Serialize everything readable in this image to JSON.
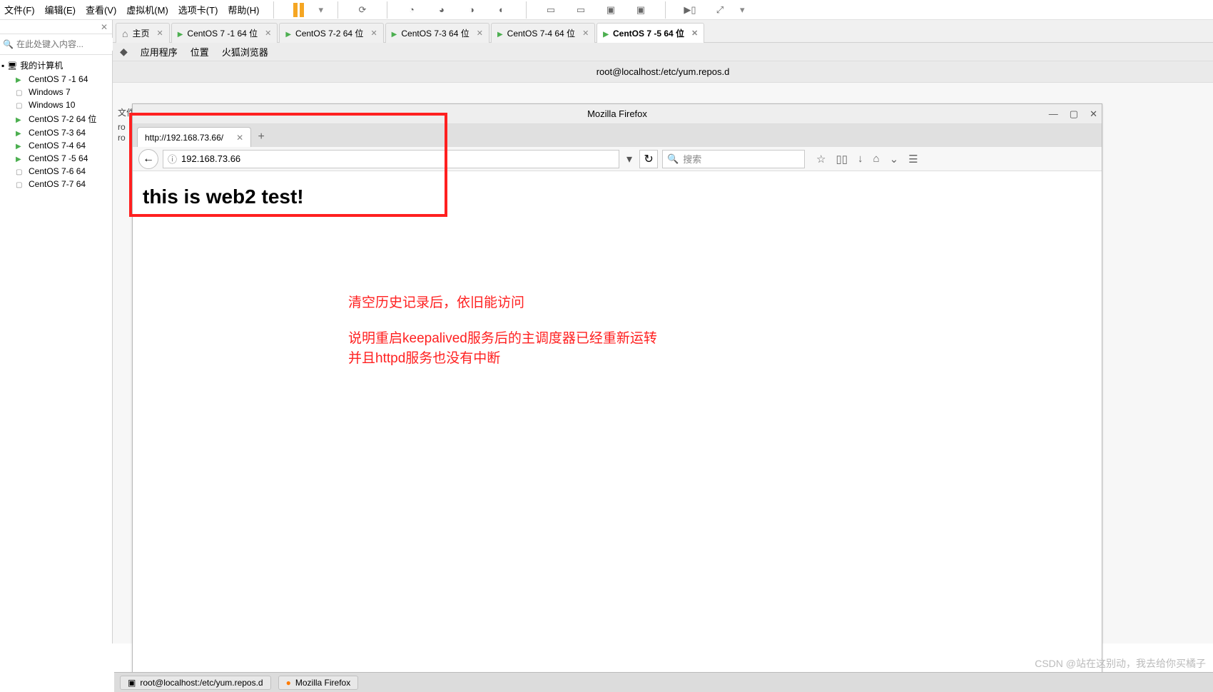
{
  "menubar": {
    "file": "文件(F)",
    "edit": "编辑(E)",
    "view": "查看(V)",
    "vm": "虚拟机(M)",
    "tabs": "选项卡(T)",
    "help": "帮助(H)"
  },
  "sidebar": {
    "search_placeholder": "在此处键入内容...",
    "root": "我的计算机",
    "items": [
      {
        "label": "CentOS 7 -1 64",
        "on": true
      },
      {
        "label": "Windows 7",
        "on": false
      },
      {
        "label": "Windows 10",
        "on": false
      },
      {
        "label": "CentOS 7-2 64 位",
        "on": true
      },
      {
        "label": "CentOS 7-3  64",
        "on": true
      },
      {
        "label": "CentOS 7-4  64",
        "on": true
      },
      {
        "label": "CentOS 7 -5 64",
        "on": true
      },
      {
        "label": "CentOS 7-6   64",
        "on": false
      },
      {
        "label": "CentOS 7-7  64",
        "on": false
      }
    ]
  },
  "tabs": [
    {
      "label": "主页",
      "type": "home",
      "active": false
    },
    {
      "label": "CentOS 7 -1 64 位",
      "type": "vm",
      "active": false
    },
    {
      "label": "CentOS 7-2 64 位",
      "type": "vm",
      "active": false
    },
    {
      "label": "CentOS 7-3  64 位",
      "type": "vm",
      "active": false
    },
    {
      "label": "CentOS 7-4  64 位",
      "type": "vm",
      "active": false
    },
    {
      "label": "CentOS 7 -5 64 位",
      "type": "vm",
      "active": true
    }
  ],
  "gnome": {
    "apps": "应用程序",
    "places": "位置",
    "firefox": "火狐浏览器"
  },
  "term_title": "root@localhost:/etc/yum.repos.d",
  "misc_labels": {
    "file": "文件",
    "line1": "ro",
    "line2": "ro"
  },
  "firefox": {
    "title": "Mozilla Firefox",
    "tab_label": "http://192.168.73.66/",
    "url": "192.168.73.66",
    "search_placeholder": "搜索",
    "page_heading": "this is web2 test!"
  },
  "annotations": {
    "line1": "清空历史记录后，依旧能访问",
    "line2": "说明重启keepalived服务后的主调度器已经重新运转",
    "line3": "并且httpd服务也没有中断"
  },
  "taskbar": {
    "item1": "root@localhost:/etc/yum.repos.d",
    "item2": "Mozilla Firefox"
  },
  "watermark": "CSDN @站在这别动，我去给你买橘子"
}
